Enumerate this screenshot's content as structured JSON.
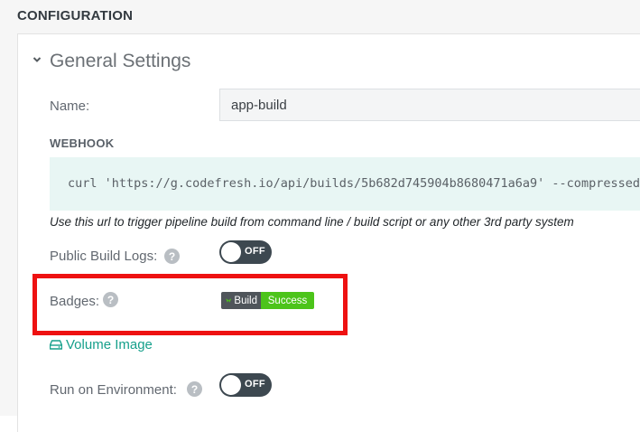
{
  "header": {
    "title": "CONFIGURATION"
  },
  "general": {
    "title": "General Settings",
    "name_label": "Name:",
    "name_value": "app-build",
    "webhook_title": "WEBHOOK",
    "webhook_url": "curl 'https://g.codefresh.io/api/builds/5b682d745904b8680471a6a9' --compressed",
    "webhook_hint": "Use this url to trigger pipeline build from command line / build script or any other 3rd party system",
    "public_logs_label": "Public Build Logs:",
    "public_logs_toggle": "OFF",
    "badges_label": "Badges:",
    "badge_left": "Build",
    "badge_right": "Success",
    "volume_link": "Volume Image",
    "run_env_label": "Run on Environment:",
    "run_env_toggle": "OFF"
  },
  "colors": {
    "accent": "#16a08b",
    "toggle_off": "#3d4850",
    "badge_success": "#4cc41a",
    "highlight": "#ee1111"
  },
  "icons": [
    "chevron-down-icon",
    "help-icon",
    "hdd-icon",
    "codefresh-logo-icon"
  ]
}
